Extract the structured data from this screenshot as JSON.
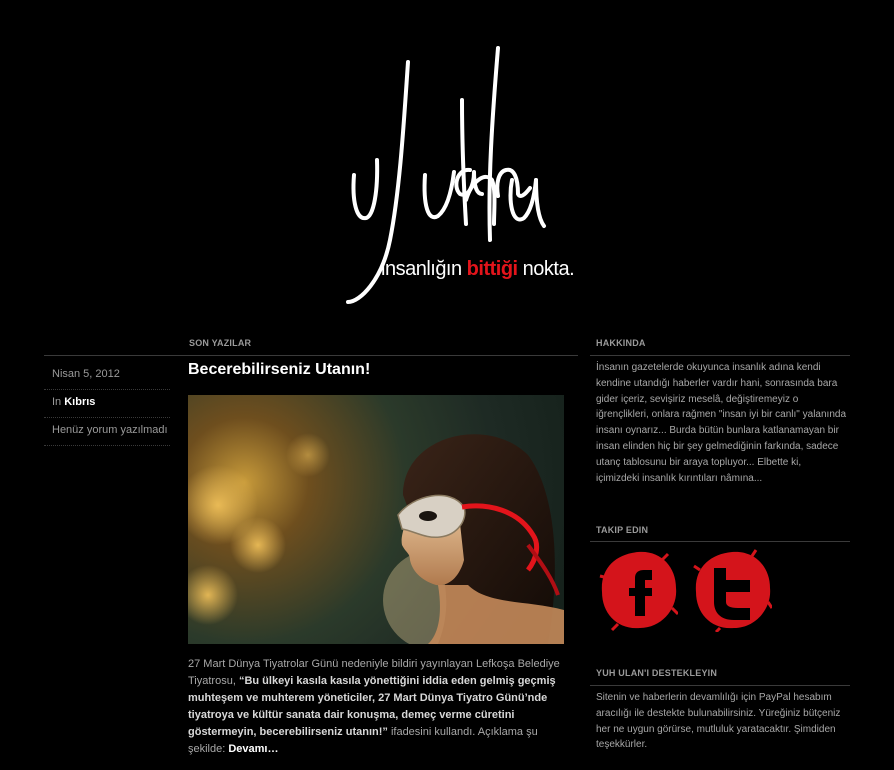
{
  "logo": {
    "title": "yuh ulan",
    "tagline_before": "insanlığın ",
    "tagline_red": "bittiği",
    "tagline_after": " nokta.",
    "accent": "#e3141b"
  },
  "sections": {
    "recent": "SON YAZILAR",
    "about": "HAKKINDA",
    "follow": "TAKIP EDIN",
    "support": "YUH ULAN'I DESTEKLEYIN"
  },
  "meta": {
    "date": "Nisan 5, 2012",
    "in_label": "In ",
    "category": "Kıbrıs",
    "comments": "Henüz yorum yazılmadı"
  },
  "post": {
    "title": "Becerebilirseniz Utanın!",
    "text_start": "27 Mart Dünya Tiyatrolar Günü nedeniyle bildiri yayınlayan Lefkoşa Belediye Tiyatrosu, ",
    "text_bold": "“Bu ülkeyi kasıla kasıla yönettiğini iddia eden gelmiş geçmiş muhteşem ve muhterem yöneticiler, 27 Mart Dünya Tiyatro Günü’nde tiyatroya ve kültür sanata dair konuşma, demeç verme cüretini göstermeyin, becerebilirseniz utanın!”",
    "text_end": " ifadesini kullandı. Açıklama şu şekilde: ",
    "more": "Devamı…"
  },
  "about_text": "İnsanın gazetelerde okuyunca insanlık adına kendi kendine utandığı haberler vardır hani, sonrasında bara gider içeriz, sevişiriz meselâ, değiştiremeyiz o iğrençlikleri, onlara rağmen \"insan iyi bir canlı\" yalanında insanı oynarız... Burda bütün bunlara katlanamayan bir insan elinden hiç bir şey gelmediğinin farkında, sadece utanç tablosunu bir araya topluyor... Elbette ki, içimizdeki insanlık kırıntıları nâmına...",
  "social": [
    {
      "name": "facebook",
      "icon": "facebook-icon",
      "letter": "f"
    },
    {
      "name": "twitter",
      "icon": "twitter-icon",
      "letter": "t"
    }
  ],
  "support_text": "Sitenin ve haberlerin devamlılığı için PayPal hesabım aracılığı ile destekte bulunabilirsiniz. Yüreğiniz bütçeniz her ne uygun görürse, mutluluk yaratacaktır. Şimdiden teşekkürler."
}
